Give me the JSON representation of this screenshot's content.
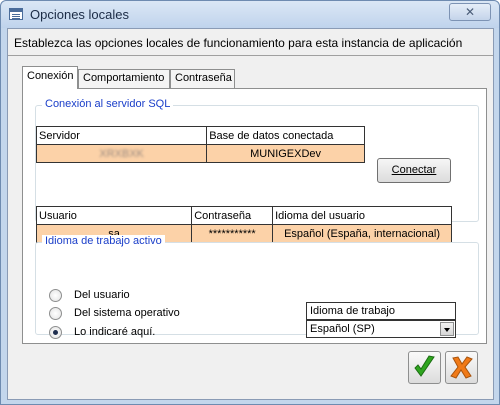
{
  "window": {
    "title": "Opciones locales",
    "close_glyph": "✕"
  },
  "header": {
    "text": "Establezca las opciones locales de funcionamiento para esta instancia de aplicación"
  },
  "tabs": [
    {
      "label": "Conexión",
      "active": true
    },
    {
      "label": "Comportamiento",
      "active": false
    },
    {
      "label": "Contraseña",
      "active": false
    }
  ],
  "sql_group": {
    "title": "Conexión al servidor SQL",
    "server_header": "Servidor",
    "server_value": "XRXBXK",
    "db_header": "Base de datos conectada",
    "db_value": "MUNIGEXDev",
    "connect_label": "Conectar"
  },
  "user_table": {
    "user_header": "Usuario",
    "user_value": "sa",
    "password_header": "Contraseña",
    "password_value": "***********",
    "language_header": "Idioma del usuario",
    "language_value": "Español (España, internacional)"
  },
  "language_group": {
    "title": "Idioma de trabajo activo",
    "options": [
      {
        "label": "Del usuario",
        "checked": false
      },
      {
        "label": "Del sistema operativo",
        "checked": false
      },
      {
        "label": "Lo indicaré aquí.",
        "checked": true
      }
    ],
    "combo_label": "Idioma de trabajo",
    "combo_value": "Español (SP)"
  },
  "colors": {
    "value_cell": "#fcd2a8",
    "group_title": "#1a3ec9",
    "accept_icon": "#2fa51f",
    "cancel_icon": "#f07a18"
  },
  "icons": {
    "accept": "green-checkmark-icon",
    "cancel": "orange-cross-icon"
  }
}
